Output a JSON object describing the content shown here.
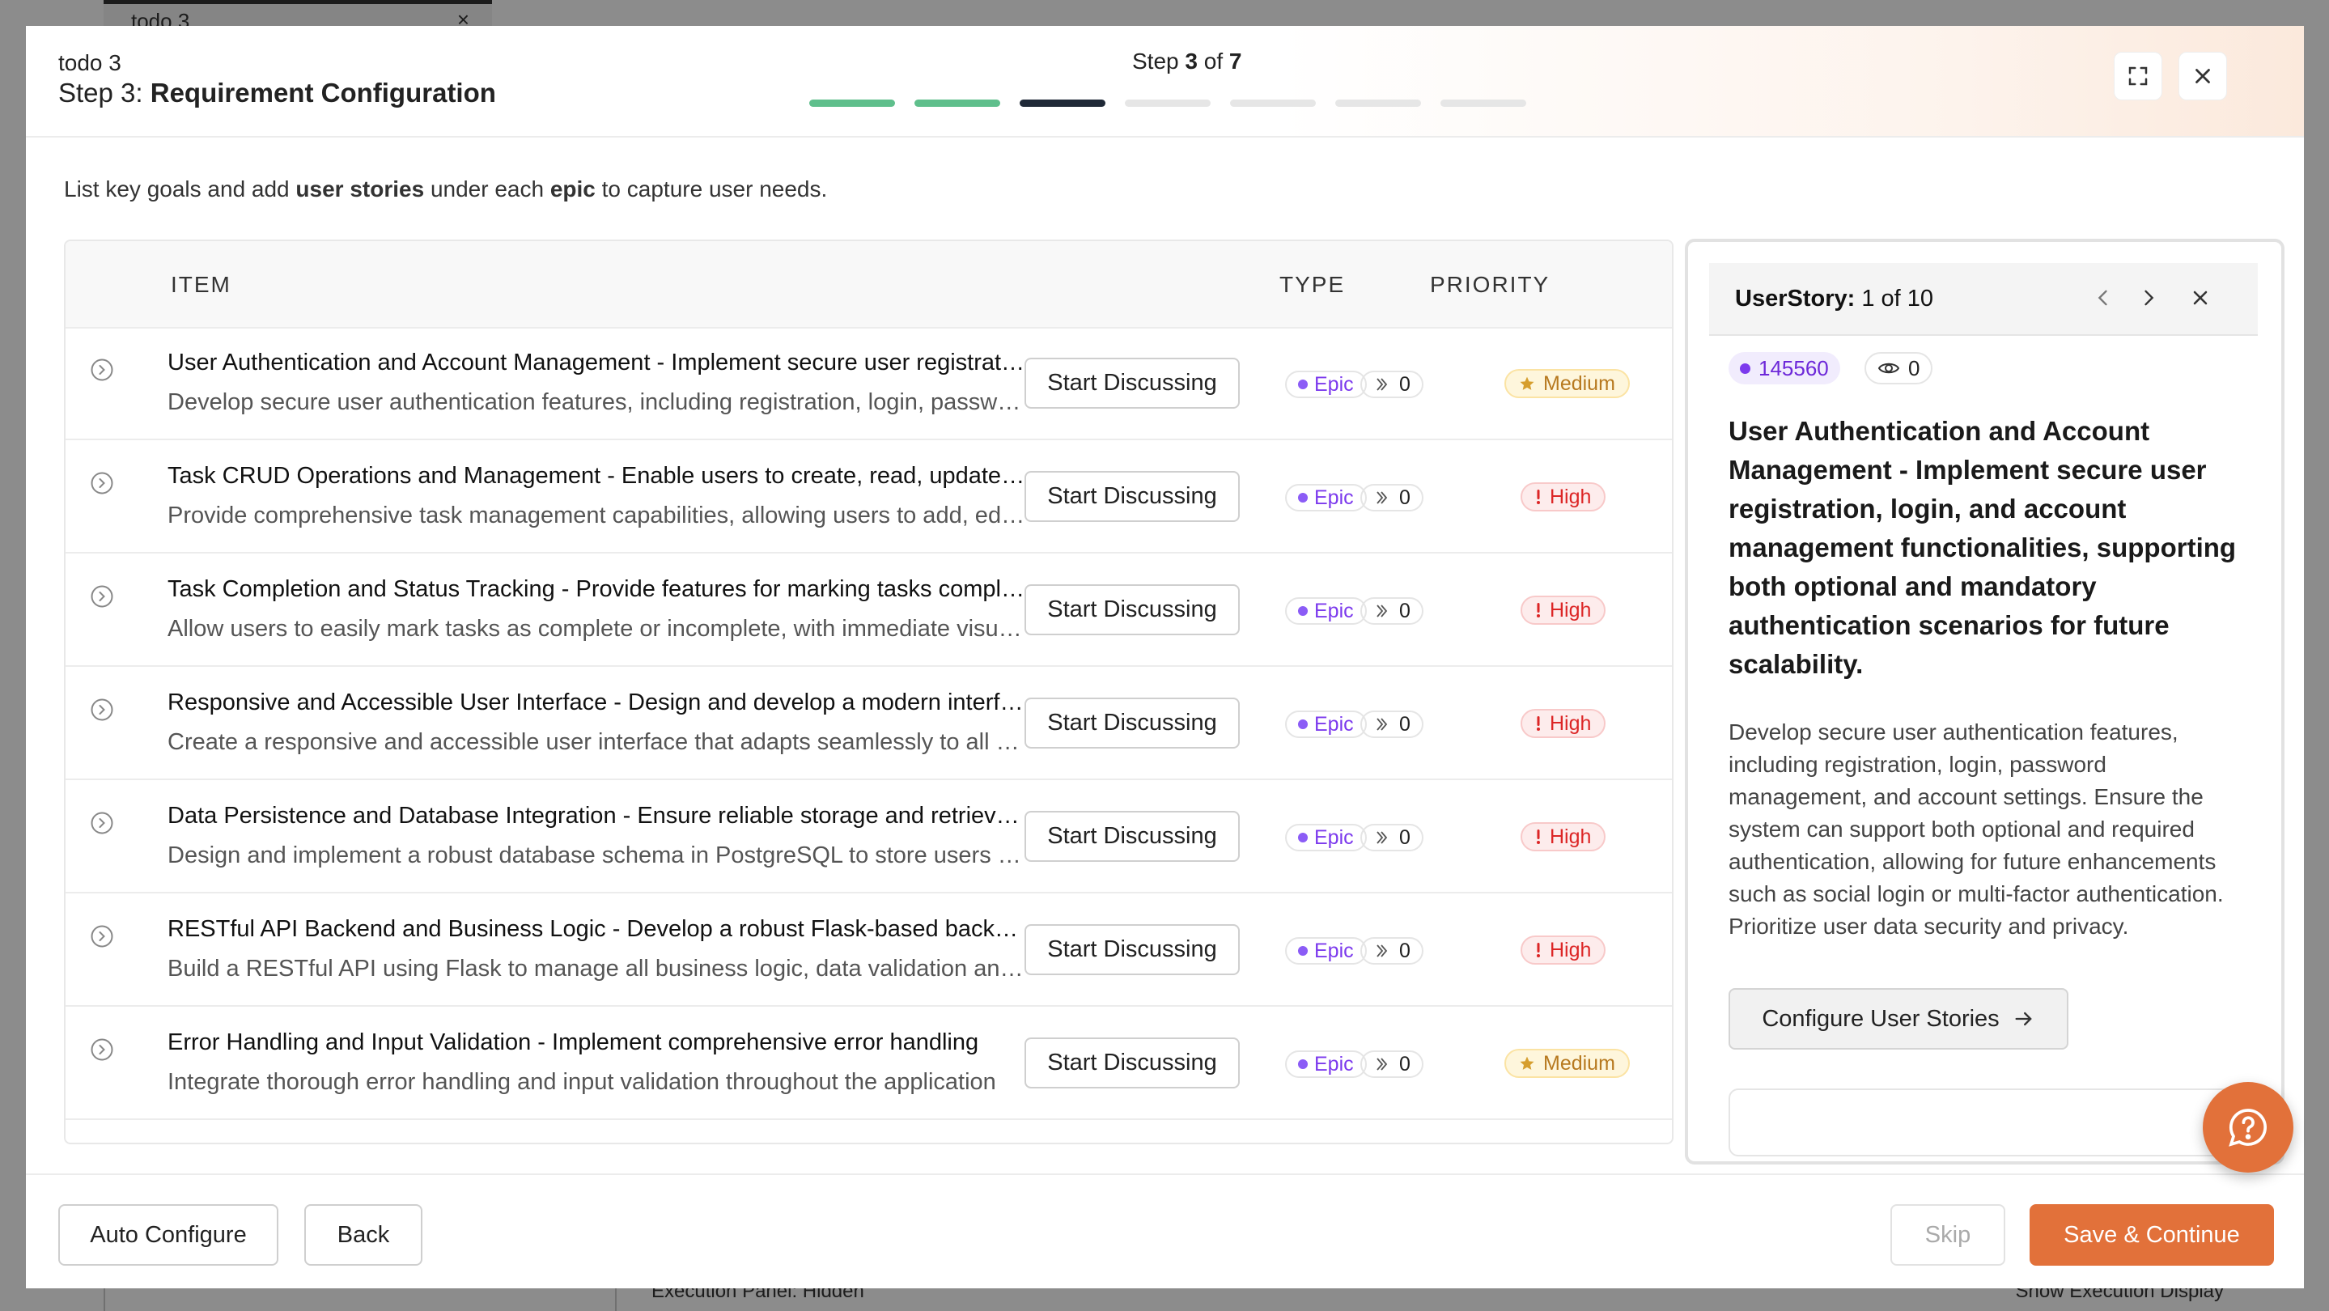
{
  "background": {
    "tab_title": "todo 3",
    "tab_close": "×",
    "footer_left": "Execution Panel: Hidden",
    "footer_right": "Show Execution Display"
  },
  "header": {
    "project": "todo 3",
    "step_prefix": "Step 3: ",
    "step_name": "Requirement Configuration",
    "step_counter": {
      "prefix": "Step ",
      "current": "3",
      "middle": " of ",
      "total": "7"
    },
    "progress": {
      "total_steps": 7,
      "completed": 2,
      "current": 3
    }
  },
  "intro": {
    "part1": "List key goals and add ",
    "bold1": "user stories",
    "part2": " under each ",
    "bold2": "epic",
    "part3": " to capture user needs."
  },
  "table": {
    "columns": {
      "item": "ITEM",
      "type": "TYPE",
      "priority": "PRIORITY"
    },
    "discuss_label": "Start Discussing",
    "rows": [
      {
        "title": "User Authentication and Account Management - Implement secure user registration, login, and account management functionalities",
        "desc": "Develop secure user authentication features, including registration, login, password management",
        "type": "Epic",
        "count": "0",
        "priority": "Medium"
      },
      {
        "title": "Task CRUD Operations and Management - Enable users to create, read, update and delete tasks",
        "desc": "Provide comprehensive task management capabilities, allowing users to add, edit and remove tasks",
        "type": "Epic",
        "count": "0",
        "priority": "High"
      },
      {
        "title": "Task Completion and Status Tracking - Provide features for marking tasks complete",
        "desc": "Allow users to easily mark tasks as complete or incomplete, with immediate visual feedback",
        "type": "Epic",
        "count": "0",
        "priority": "High"
      },
      {
        "title": "Responsive and Accessible User Interface - Design and develop a modern interface",
        "desc": "Create a responsive and accessible user interface that adapts seamlessly to all devices",
        "type": "Epic",
        "count": "0",
        "priority": "High"
      },
      {
        "title": "Data Persistence and Database Integration - Ensure reliable storage and retrieval of data",
        "desc": "Design and implement a robust database schema in PostgreSQL to store users and tasks",
        "type": "Epic",
        "count": "0",
        "priority": "High"
      },
      {
        "title": "RESTful API Backend and Business Logic - Develop a robust Flask-based backend",
        "desc": "Build a RESTful API using Flask to manage all business logic, data validation and persistence",
        "type": "Epic",
        "count": "0",
        "priority": "High"
      },
      {
        "title": "Error Handling and Input Validation - Implement comprehensive error handling",
        "desc": "Integrate thorough error handling and input validation throughout the application",
        "type": "Epic",
        "count": "0",
        "priority": "Medium"
      }
    ]
  },
  "side_panel": {
    "label": "UserStory:",
    "position": "1 of 10",
    "id": "145560",
    "views": "0",
    "title": "User Authentication and Account Management - Implement secure user registration, login, and account management functionalities, supporting both optional and mandatory authentication scenarios for future scalability.",
    "description": "Develop secure user authentication features, including registration, login, password management, and account settings. Ensure the system can support both optional and required authentication, allowing for future enhancements such as social login or multi-factor authentication. Prioritize user data security and privacy.",
    "button": "Configure User Stories"
  },
  "footer": {
    "auto_configure": "Auto Configure",
    "back": "Back",
    "skip": "Skip",
    "save": "Save & Continue"
  },
  "colors": {
    "accent": "#e2713a",
    "progress_done": "#5fbf8c",
    "progress_current": "#1f2937",
    "epic": "#7c3aed",
    "high": "#dc2626",
    "medium": "#b7791f"
  },
  "icons": {
    "fullscreen": "fullscreen-icon",
    "close": "close-icon",
    "expand": "expand-circle-icon",
    "count": "links-icon",
    "star": "star-icon",
    "exclamation": "exclamation-icon",
    "prev": "chevron-left-icon",
    "next": "chevron-right-icon",
    "eye": "eye-icon",
    "arrow": "arrow-right-icon",
    "help": "help-chat-icon"
  }
}
